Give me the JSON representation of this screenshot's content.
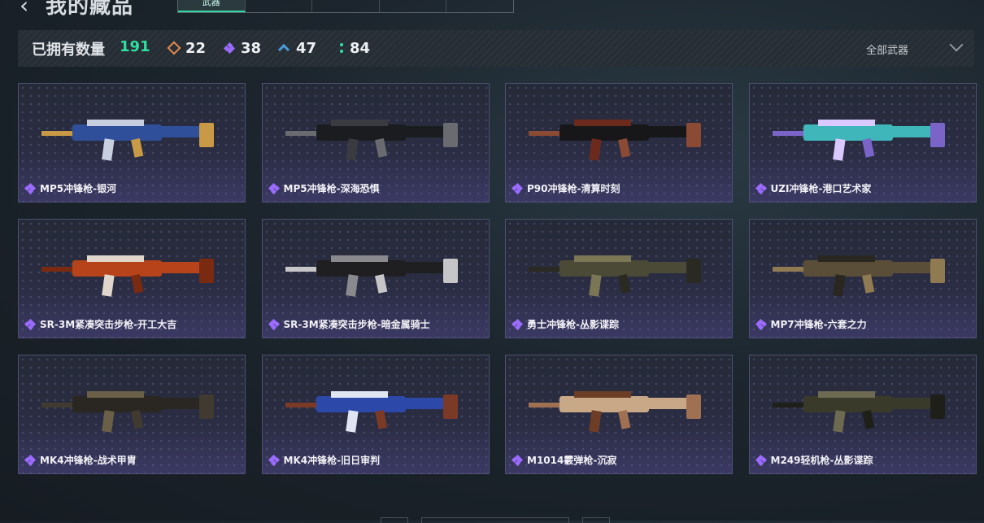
{
  "header": {
    "title": "我的藏品",
    "back_icon": "back-arrow-icon",
    "tabs": [
      {
        "label": "武器",
        "active": true
      },
      {
        "label": "",
        "active": false
      },
      {
        "label": "",
        "active": false
      },
      {
        "label": "",
        "active": false
      },
      {
        "label": "",
        "active": false
      }
    ]
  },
  "summary": {
    "owned_label": "已拥有数量",
    "owned_count": "191",
    "stats": [
      {
        "icon": "orange-diamond-icon",
        "value": "22",
        "color": "#e38a4d"
      },
      {
        "icon": "purple-diamond-icon",
        "value": "38",
        "color": "#9b6cff"
      },
      {
        "icon": "blue-chevron-icon",
        "value": "47",
        "color": "#4a9ad8"
      },
      {
        "icon": "green-dots-icon",
        "value": "84",
        "color": "#2fe0a0"
      }
    ],
    "filter": {
      "selected": "全部武器",
      "icon": "chevron-down-icon"
    }
  },
  "items": [
    {
      "name": "MP5冲锋枪-银河",
      "palette": [
        "#2f4f9a",
        "#c7cfe0",
        "#c89a45"
      ]
    },
    {
      "name": "MP5冲锋枪-深海恐惧",
      "palette": [
        "#1b1c20",
        "#3a3b40",
        "#6a6b70"
      ]
    },
    {
      "name": "P90冲锋枪-清算时刻",
      "palette": [
        "#17171a",
        "#6b2a1c",
        "#8a4a33"
      ]
    },
    {
      "name": "UZI冲锋枪-港口艺术家",
      "palette": [
        "#3fb6b9",
        "#d9c9ff",
        "#7a64c8"
      ]
    },
    {
      "name": "SR-3M紧凑突击步枪-开工大吉",
      "palette": [
        "#b6431a",
        "#e0d6cc",
        "#7b2a12"
      ]
    },
    {
      "name": "SR-3M紧凑突击步枪-暗金属骑士",
      "palette": [
        "#1f1f22",
        "#8a8a8e",
        "#c6c6c8"
      ]
    },
    {
      "name": "勇士冲锋枪-丛影谍踪",
      "palette": [
        "#4a4a36",
        "#7b7656",
        "#2a2a22"
      ]
    },
    {
      "name": "MP7冲锋枪-六套之力",
      "palette": [
        "#5a4e38",
        "#2a2620",
        "#8f7a52"
      ]
    },
    {
      "name": "MK4冲锋枪-战术甲胄",
      "palette": [
        "#2a2722",
        "#6a6048",
        "#403a30"
      ]
    },
    {
      "name": "MK4冲锋枪-旧日审判",
      "palette": [
        "#2c48a8",
        "#dfe6f2",
        "#7a3a26"
      ]
    },
    {
      "name": "M1014霰弹枪-沉寂",
      "palette": [
        "#c9a887",
        "#6e3d26",
        "#a07052"
      ]
    },
    {
      "name": "M249轻机枪-丛影谍踪",
      "palette": [
        "#3a3a2a",
        "#6c6a50",
        "#1f1f1a"
      ]
    }
  ]
}
